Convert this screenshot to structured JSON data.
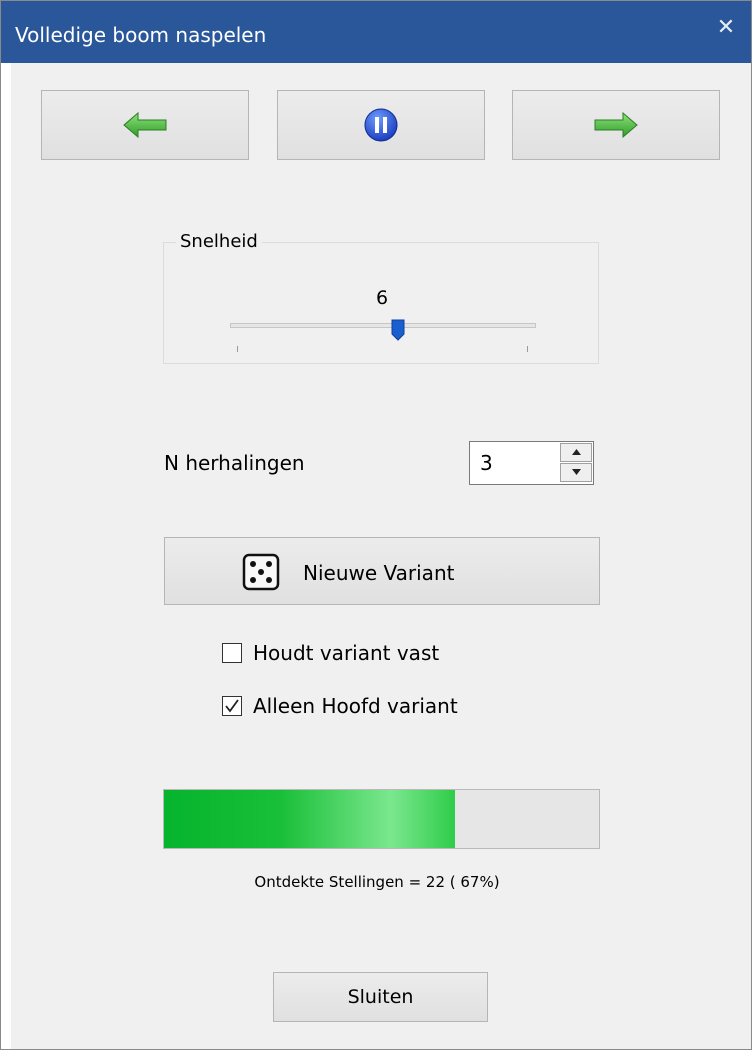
{
  "window": {
    "title": "Volledige boom naspelen",
    "close_glyph": "✕"
  },
  "nav": {
    "back_icon": "arrow-left-icon",
    "pause_icon": "pause-icon",
    "forward_icon": "arrow-right-icon"
  },
  "speed": {
    "label": "Snelheid",
    "value": "6",
    "level_fraction": 0.55
  },
  "repetitions": {
    "label": "N herhalingen",
    "value": "3"
  },
  "new_variant": {
    "label": "Nieuwe Variant",
    "icon": "dice-icon"
  },
  "options": {
    "hold_variant": {
      "label": "Houdt variant vast",
      "checked": false
    },
    "main_variant_only": {
      "label": "Alleen Hoofd variant",
      "checked": true
    }
  },
  "progress": {
    "percent": 67,
    "text": "Ontdekte Stellingen = 22 ( 67%)"
  },
  "footer": {
    "close_label": "Sluiten"
  },
  "colors": {
    "titlebar": "#2a579a",
    "progress_green": "#19bf38",
    "accent_blue": "#1a5fd0"
  }
}
